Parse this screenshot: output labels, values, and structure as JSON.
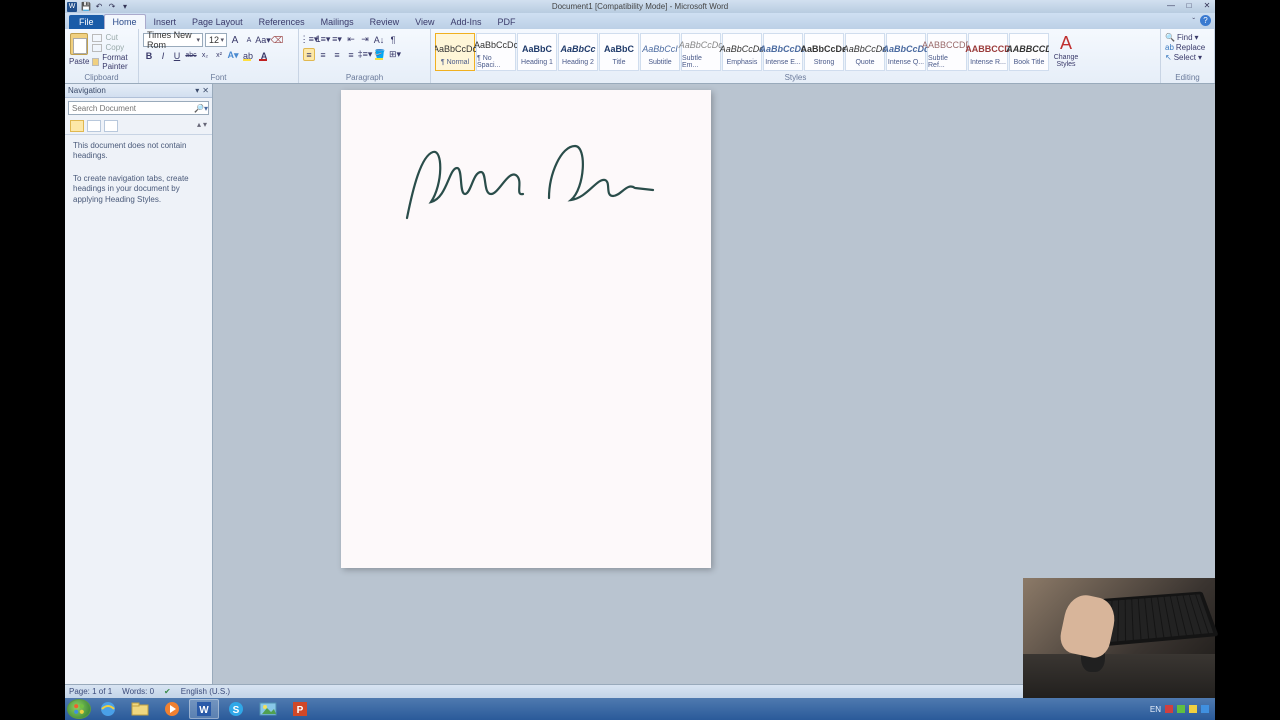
{
  "title": "Document1 [Compatibility Mode] - Microsoft Word",
  "qat": {
    "save": "💾",
    "undo": "↶",
    "redo": "↷"
  },
  "tabs": [
    "File",
    "Home",
    "Insert",
    "Page Layout",
    "References",
    "Mailings",
    "Review",
    "View",
    "Add-Ins",
    "PDF"
  ],
  "activeTab": "Home",
  "ribbon": {
    "clipboard": {
      "label": "Clipboard",
      "paste": "Paste",
      "cut": "Cut",
      "copy": "Copy",
      "fmt": "Format Painter"
    },
    "font": {
      "label": "Font",
      "family": "Times New Rom",
      "size": "12",
      "grow": "A",
      "shrink": "A",
      "clear": "Aa",
      "bold": "B",
      "italic": "I",
      "underline": "U",
      "strike": "abc",
      "sub": "x₂",
      "sup": "x²",
      "effects": "A"
    },
    "paragraph": {
      "label": "Paragraph"
    },
    "styles": {
      "label": "Styles",
      "items": [
        {
          "prev": "AaBbCcDc",
          "lbl": "¶ Normal",
          "sel": true,
          "color": "#333"
        },
        {
          "prev": "AaBbCcDc",
          "lbl": "¶ No Spaci...",
          "color": "#333"
        },
        {
          "prev": "AaBbC",
          "lbl": "Heading 1",
          "color": "#1f3a6a",
          "bold": true
        },
        {
          "prev": "AaBbCc",
          "lbl": "Heading 2",
          "color": "#1f3a6a",
          "bold": true,
          "italic": true
        },
        {
          "prev": "AaBbC",
          "lbl": "Title",
          "color": "#1f3a6a",
          "bold": true
        },
        {
          "prev": "AaBbCcI",
          "lbl": "Subtitle",
          "color": "#4a6aa0",
          "italic": true
        },
        {
          "prev": "AaBbCcDd",
          "lbl": "Subtle Em...",
          "color": "#888",
          "italic": true
        },
        {
          "prev": "AaBbCcDd",
          "lbl": "Emphasis",
          "color": "#333",
          "italic": true
        },
        {
          "prev": "AaBbCcDd",
          "lbl": "Intense E...",
          "color": "#4a6aa0",
          "bold": true,
          "italic": true
        },
        {
          "prev": "AaBbCcDd",
          "lbl": "Strong",
          "color": "#333",
          "bold": true
        },
        {
          "prev": "AaBbCcDd",
          "lbl": "Quote",
          "color": "#333",
          "italic": true
        },
        {
          "prev": "AaBbCcDd",
          "lbl": "Intense Q...",
          "color": "#4a6aa0",
          "bold": true,
          "italic": true
        },
        {
          "prev": "AABBCCDD",
          "lbl": "Subtle Ref...",
          "color": "#9a6a6a"
        },
        {
          "prev": "AABBCCD",
          "lbl": "Intense R...",
          "color": "#9a3a3a",
          "bold": true
        },
        {
          "prev": "AABBCCD",
          "lbl": "Book Title",
          "color": "#333",
          "bold": true,
          "italic": true
        }
      ],
      "change": "Change Styles"
    },
    "editing": {
      "label": "Editing",
      "find": "Find",
      "replace": "Replace",
      "select": "Select"
    }
  },
  "nav": {
    "title": "Navigation",
    "search_placeholder": "Search Document",
    "msg1": "This document does not contain headings.",
    "msg2": "To create navigation tabs, create headings in your document by applying Heading Styles."
  },
  "document": {
    "signature": "Jane Doe"
  },
  "status": {
    "page": "Page: 1 of 1",
    "words": "Words: 0",
    "lang": "English (U.S.)"
  },
  "tray": {
    "lang": "EN"
  }
}
